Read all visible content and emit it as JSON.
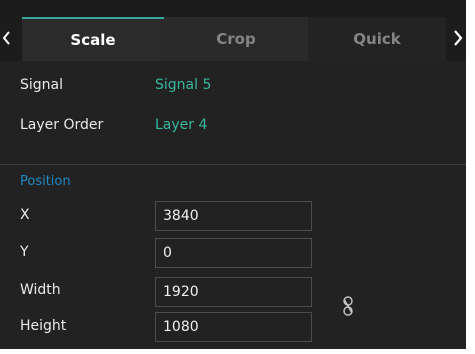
{
  "tabs": {
    "scale": "Scale",
    "crop": "Crop",
    "quick": "Quick",
    "prev_icon": "chevron-left-icon",
    "next_icon": "chevron-right-icon",
    "active": "Scale"
  },
  "info": {
    "signal_label": "Signal",
    "signal_value": "Signal  5",
    "layer_order_label": "Layer Order",
    "layer_order_value": "Layer 4"
  },
  "position": {
    "section_title": "Position",
    "x_label": "X",
    "x_value": "3840",
    "y_label": "Y",
    "y_value": "0",
    "width_label": "Width",
    "width_value": "1920",
    "height_label": "Height",
    "height_value": "1080",
    "lock_icon": "link-aspect-ratio-icon"
  },
  "colors": {
    "background": "#222222",
    "accent_teal": "#35b79f",
    "accent_blue": "#1e8ac6",
    "text": "#eaeaea",
    "muted_text": "#858585"
  }
}
